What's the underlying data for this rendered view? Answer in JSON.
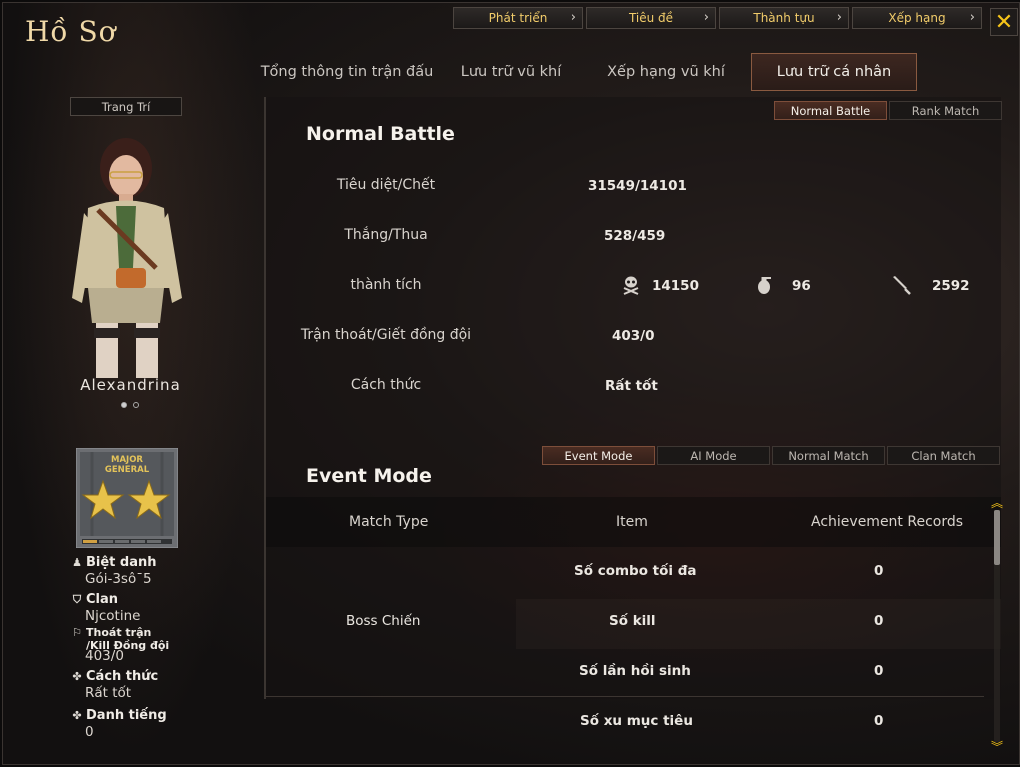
{
  "title": "Hồ Sơ",
  "top_nav": [
    {
      "label": "Phát triển"
    },
    {
      "label": "Tiêu đề"
    },
    {
      "label": "Thành tựu"
    },
    {
      "label": "Xếp hạng"
    }
  ],
  "close_icon": "close-icon",
  "tabs": [
    {
      "label": "Tổng thông tin trận đấu",
      "active": false
    },
    {
      "label": "Lưu trữ vũ khí",
      "active": false
    },
    {
      "label": "Xếp hạng vũ khí",
      "active": false
    },
    {
      "label": "Lưu trữ cá nhân",
      "active": true
    }
  ],
  "left": {
    "decor_button": "Trang Trí",
    "character_name": "Alexandrina",
    "carousel": {
      "count": 2,
      "active": 1
    },
    "rank_badge": {
      "line1": "MAJOR",
      "line2": "GENERAL",
      "stars": 2
    },
    "profile": {
      "nickname_label": "Biệt danh",
      "nickname_value": "Gói-3sô¯5",
      "clan_label": "Clan",
      "clan_value": "Njcotine",
      "escape_label_1": "Thoát trận",
      "escape_label_2": "/Kill Đồng đội",
      "escape_value": "403/0",
      "style_label": "Cách thức",
      "style_value": "Rất tốt",
      "reputation_label": "Danh tiếng",
      "reputation_value": "0"
    }
  },
  "battle_filter": [
    {
      "label": "Normal Battle",
      "active": true
    },
    {
      "label": "Rank Match",
      "active": false
    }
  ],
  "normal_battle": {
    "title": "Normal Battle",
    "rows": [
      {
        "label": "Tiêu diệt/Chết",
        "value": "31549/14101"
      },
      {
        "label": "Thắng/Thua",
        "value": "528/459"
      },
      {
        "label": "thành tích",
        "value": ""
      },
      {
        "label": "Trận thoát/Giết đồng đội",
        "value": "403/0"
      },
      {
        "label": "Cách thức",
        "value": "Rất tốt"
      }
    ],
    "achievements": [
      {
        "icon": "skull-crossbones-icon",
        "value": "14150"
      },
      {
        "icon": "grenade-icon",
        "value": "96"
      },
      {
        "icon": "knife-icon",
        "value": "2592"
      }
    ]
  },
  "event_filter": [
    {
      "label": "Event Mode",
      "active": true
    },
    {
      "label": "AI Mode",
      "active": false
    },
    {
      "label": "Normal Match",
      "active": false
    },
    {
      "label": "Clan Match",
      "active": false
    }
  ],
  "event_mode": {
    "title": "Event Mode",
    "headers": {
      "match_type": "Match Type",
      "item": "Item",
      "records": "Achievement Records"
    },
    "match_type": "Boss Chiến",
    "rows": [
      {
        "item": "Số combo tối đa",
        "record": "0"
      },
      {
        "item": "Số kill",
        "record": "0"
      },
      {
        "item": "Số lần hồi sinh",
        "record": "0"
      },
      {
        "item": "Số xu mục tiêu",
        "record": "0"
      }
    ]
  },
  "colors": {
    "accent_gold": "#f1cc6a",
    "close_yellow": "#f5c419",
    "active_tab": "#3d2720"
  }
}
